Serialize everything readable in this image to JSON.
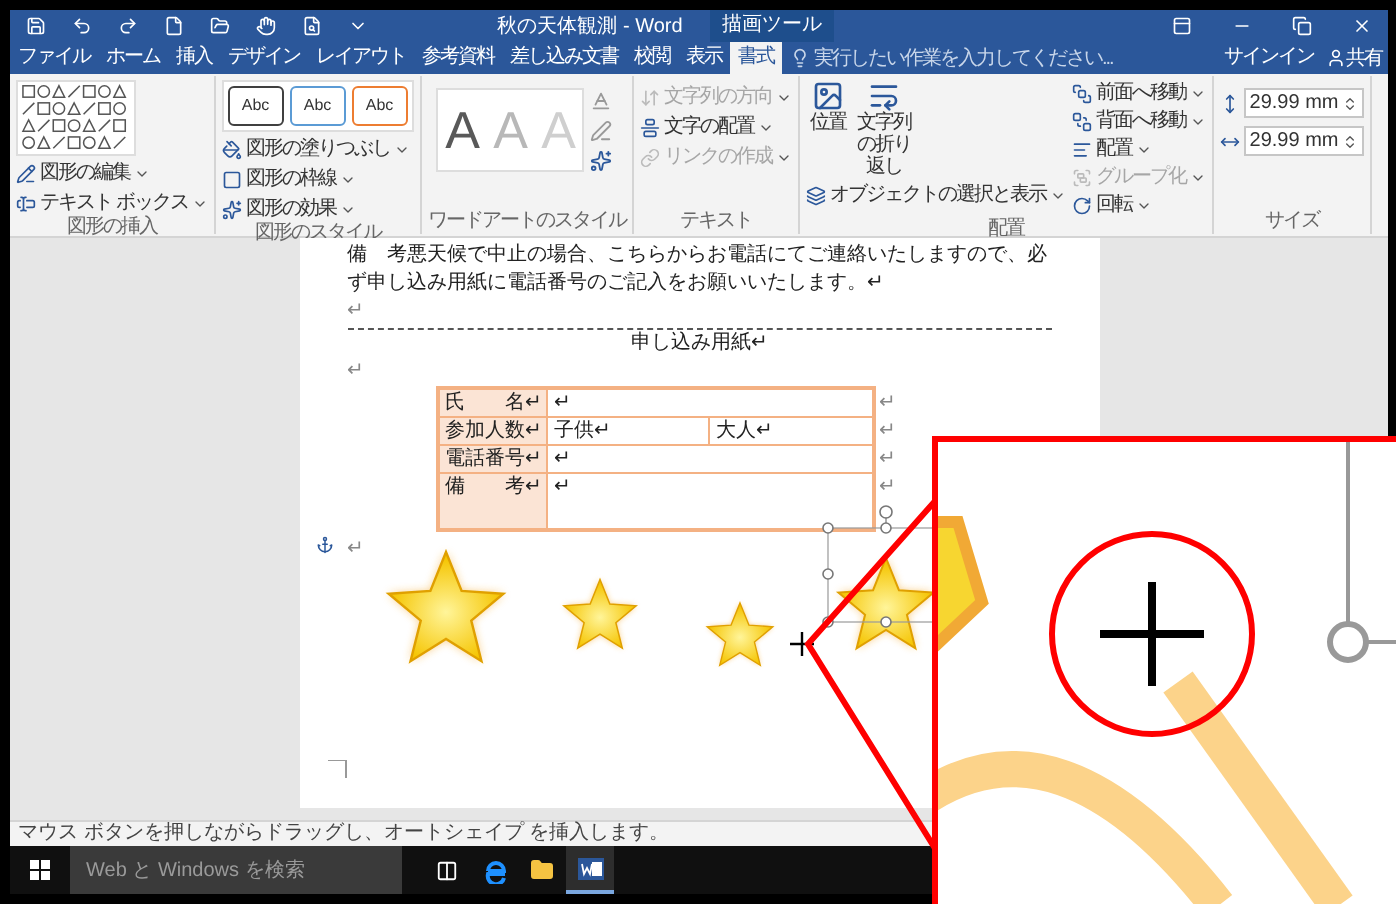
{
  "title_bar": {
    "quick_access": [
      {
        "kind": "save"
      },
      {
        "kind": "undo"
      },
      {
        "kind": "redo"
      },
      {
        "kind": "new"
      },
      {
        "kind": "open"
      },
      {
        "kind": "touch"
      },
      {
        "kind": "preview"
      },
      {
        "kind": "customize"
      }
    ],
    "title": "秋の天体観測 - Word",
    "context_tab": "描画ツール"
  },
  "tabs": [
    {
      "label": "ファイル",
      "selected": false
    },
    {
      "label": "ホーム",
      "selected": false
    },
    {
      "label": "挿入",
      "selected": false
    },
    {
      "label": "デザイン",
      "selected": false
    },
    {
      "label": "レイアウト",
      "selected": false
    },
    {
      "label": "参考資料",
      "selected": false
    },
    {
      "label": "差し込み文書",
      "selected": false
    },
    {
      "label": "校閲",
      "selected": false
    },
    {
      "label": "表示",
      "selected": false
    },
    {
      "label": "書式",
      "selected": true
    }
  ],
  "tell_me": {
    "placeholder": "実行したい作業を入力してください..."
  },
  "sign_in": "サインイン",
  "share": "共有",
  "ribbon": {
    "groups": [
      {
        "kind": "insert_shapes",
        "label": "図形の挿入",
        "commands": [
          "図形の編集",
          "テキスト ボックス"
        ]
      },
      {
        "kind": "shape_styles",
        "label": "図形のスタイル",
        "presets": [
          {
            "text": "Abc",
            "color": "#404040"
          },
          {
            "text": "Abc",
            "color": "#5b9bd5"
          },
          {
            "text": "Abc",
            "color": "#ed7d31"
          }
        ],
        "commands": [
          "図形の塗りつぶし",
          "図形の枠線",
          "図形の効果"
        ]
      },
      {
        "kind": "wordart",
        "label": "ワードアートのスタイル",
        "samples": [
          {
            "text": "A",
            "color": "#595959"
          },
          {
            "text": "A",
            "color": "#b8b8b8"
          },
          {
            "text": "A",
            "color": "#cfcfcf"
          }
        ]
      },
      {
        "kind": "text",
        "label": "テキスト",
        "commands": [
          {
            "label": "文字列の方向",
            "disabled": true
          },
          {
            "label": "文字の配置",
            "disabled": false
          },
          {
            "label": "リンクの作成",
            "disabled": true
          }
        ]
      },
      {
        "kind": "arrange",
        "label": "配置",
        "large": [
          "位置",
          "文字列の折り返し"
        ],
        "commands": [
          {
            "label": "オブジェクトの選択と表示",
            "disabled": false
          },
          {
            "label": "前面へ移動",
            "disabled": false
          },
          {
            "label": "背面へ移動",
            "disabled": false
          },
          {
            "label": "配置",
            "disabled": false
          },
          {
            "label": "グループ化",
            "disabled": true
          },
          {
            "label": "回転",
            "disabled": false
          }
        ]
      },
      {
        "kind": "size",
        "label": "サイズ",
        "fields": [
          "29.99 mm",
          "29.99 mm"
        ]
      }
    ]
  },
  "document": {
    "paragraph": "備　考悪天候で中止の場合、こちらからお電話にてご連絡いたしますので、必ず申し込み用紙に電話番号のご記入をお願いいたします。↵",
    "mark_before_rule": "↵",
    "form_title": "申し込み用紙↵",
    "mark_after_title": "↵",
    "form_rows": [
      {
        "label": "氏　　名↵",
        "cells": [
          "↵"
        ],
        "end": "↵"
      },
      {
        "label": "参加人数↵",
        "cells": [
          "子供↵",
          "大人↵"
        ],
        "end": "↵"
      },
      {
        "label": "電話番号↵",
        "cells": [
          "↵"
        ],
        "end": "↵"
      },
      {
        "label": "備　　考↵",
        "cells": [
          "↵"
        ],
        "end": "↵"
      }
    ],
    "mark_after_table": "↵"
  },
  "status_bar": "マウス ボタンを押しながらドラッグし、オートシェイプ を挿入します。",
  "taskbar": {
    "search": {
      "placeholder": "Web と Windows を検索"
    },
    "apps": [
      {
        "kind": "task_view",
        "active": false
      },
      {
        "kind": "edge",
        "active": false
      },
      {
        "kind": "explorer",
        "active": false
      },
      {
        "kind": "word",
        "active": true
      }
    ]
  }
}
